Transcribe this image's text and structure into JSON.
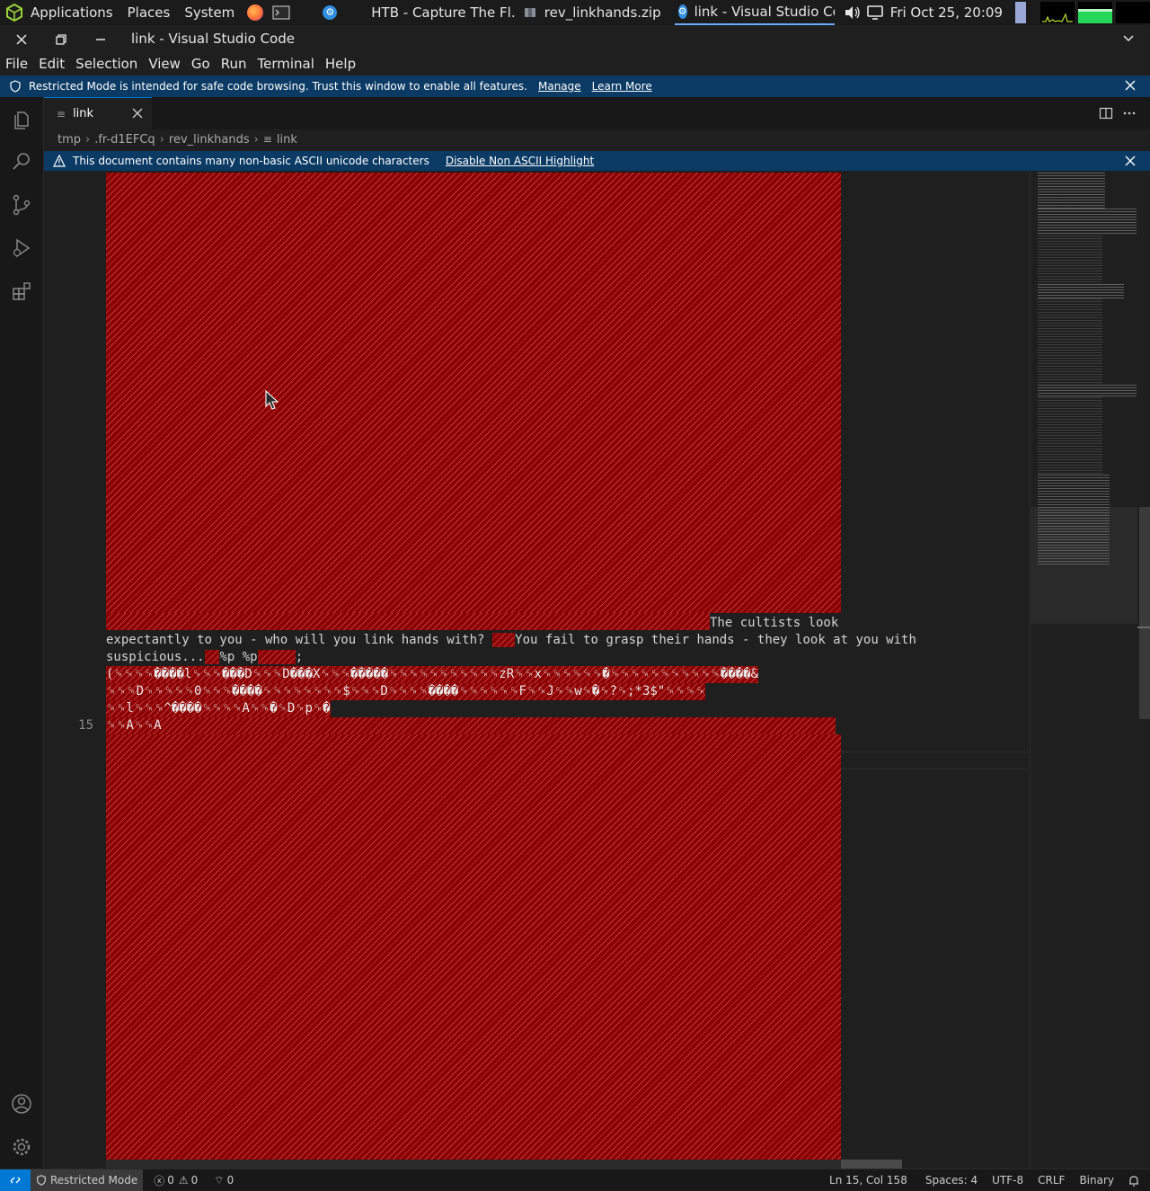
{
  "panel": {
    "applications": "Applications",
    "places": "Places",
    "system": "System",
    "tasks": [
      {
        "label": "HTB - Capture The Fl..."
      },
      {
        "label": "rev_linkhands.zip"
      },
      {
        "label": "link - Visual Studio Code"
      }
    ],
    "clock": "Fri Oct 25, 20:09"
  },
  "window": {
    "title": "link - Visual Studio Code"
  },
  "menu": [
    "File",
    "Edit",
    "Selection",
    "View",
    "Go",
    "Run",
    "Terminal",
    "Help"
  ],
  "restricted_banner": {
    "message": "Restricted Mode is intended for safe code browsing. Trust this window to enable all features.",
    "manage": "Manage",
    "learn_more": "Learn More"
  },
  "tab": {
    "label": "link"
  },
  "breadcrumb": [
    "tmp",
    ".fr-d1EFCq",
    "rev_linkhands",
    "link"
  ],
  "ascii_banner": {
    "message": "This document contains many non-basic ASCII unicode characters",
    "action": "Disable Non ASCII Highlight"
  },
  "editor": {
    "line_number": "15",
    "lines": [
      {
        "pre": "",
        "text": "The cultists look"
      },
      {
        "pre": "expectantly to you - who will you link hands with? ",
        "text": "You fail to grasp their hands - they look at you with"
      },
      {
        "pre": "suspicious...",
        "text": "%p %p",
        "post": ";"
      },
      {
        "text": "(␍␍␍␍����l␍␍␍���D␍␍␍D���X␍␍␍�����␍␍␍␍␍␍␍␍␍␍␍zR␍␍x␍␍␍␍␍␍�␍␍␍␍␍␍␍␍␍␍␍����&"
      },
      {
        "text": "␍␍␍D␍␍␍␍␍0␍␍␍����␍␍␍␍␍␍␍␍$␍␍␍D␍␍␍␍����␍␍␍␍␍␍F␍␍J␍␍w␍�␍?␍;*3$\"␍␍␍␍"
      },
      {
        "text": "␍␍l␍␍␍^����␍␍␍␍A␍␍�␍D␍p␍�"
      },
      {
        "text": "␍␍A␍␍A"
      }
    ]
  },
  "status": {
    "restricted": "Restricted Mode",
    "errors": "0",
    "warnings": "0",
    "ports": "0",
    "position": "Ln 15, Col 158",
    "spaces": "Spaces: 4",
    "encoding": "UTF-8",
    "eol": "CRLF",
    "language": "Binary"
  },
  "colors": {
    "accent": "#0078d4",
    "banner": "#0b3a64",
    "highlight": "#8b0000"
  }
}
